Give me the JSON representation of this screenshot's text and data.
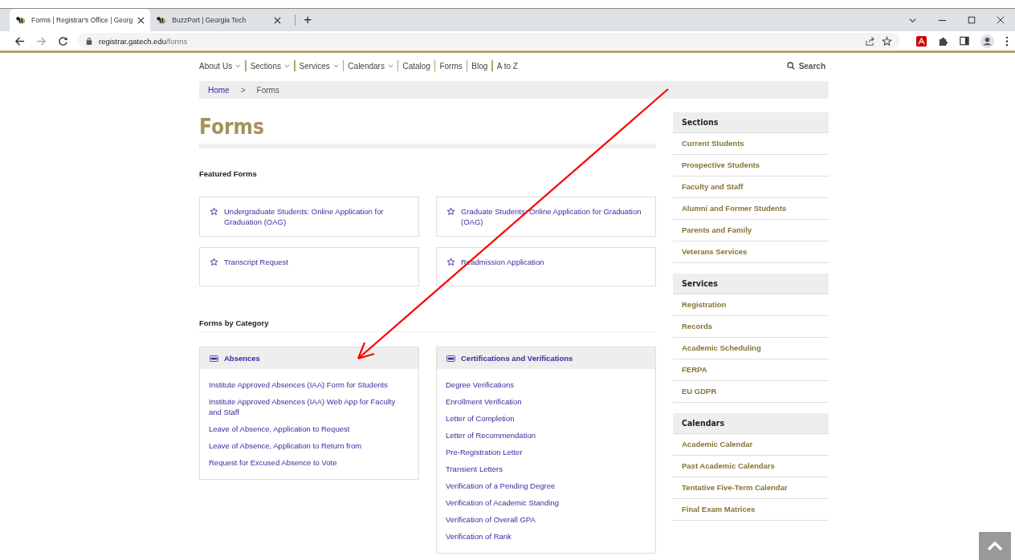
{
  "browser": {
    "tabs": [
      {
        "title": "Forms | Registrar's Office | Georg",
        "selected": true
      },
      {
        "title": "BuzzPort | Georgia Tech",
        "selected": false
      }
    ],
    "new_tab": "+",
    "url_host": "registrar.gatech.edu",
    "url_path": "/forms",
    "forward_disabled": true
  },
  "nav": {
    "items": [
      {
        "label": "About Us",
        "dropdown": true
      },
      {
        "label": "Sections",
        "dropdown": true
      },
      {
        "label": "Services",
        "dropdown": true
      },
      {
        "label": "Calendars",
        "dropdown": true
      },
      {
        "label": "Catalog",
        "dropdown": false
      },
      {
        "label": "Forms",
        "dropdown": false
      },
      {
        "label": "Blog",
        "dropdown": false
      },
      {
        "label": "A to Z",
        "dropdown": false
      }
    ],
    "search": "Search"
  },
  "breadcrumb": {
    "items": [
      "Home"
    ],
    "separator": ">",
    "current": "Forms"
  },
  "page_title": "Forms",
  "featured": {
    "heading": "Featured Forms",
    "items": [
      "Undergraduate Students: Online Application for Graduation (OAG)",
      "Graduate Students: Online Application for Graduation (OAG)",
      "Transcript Request",
      "Readmission Application"
    ]
  },
  "categories": {
    "heading": "Forms by Category",
    "groups": [
      {
        "title": "Absences",
        "links": [
          "Institute Approved Absences (IAA) Form for Students",
          "Institute Approved Absences (IAA) Web App for Faculty and Staff",
          "Leave of Absence, Application to Request",
          "Leave of Absence, Application to Return from",
          "Request for Excused Absence to Vote"
        ]
      },
      {
        "title": "Certifications and Verifications",
        "links": [
          "Degree Verifications",
          "Enrollment Verification",
          "Letter of Completion",
          "Letter of Recommendation",
          "Pre-Registration Letter",
          "Transient Letters",
          "Verification of a Pending Degree",
          "Verification of Academic Standing",
          "Verification of Overall GPA",
          "Verification of Rank"
        ]
      }
    ]
  },
  "sidebar": [
    {
      "heading": "Sections",
      "items": [
        "Current Students",
        "Prospective Students",
        "Faculty and Staff",
        "Alumni and Former Students",
        "Parents and Family",
        "Veterans Services"
      ]
    },
    {
      "heading": "Services",
      "items": [
        "Registration",
        "Records",
        "Academic Scheduling",
        "FERPA",
        "EU GDPR"
      ]
    },
    {
      "heading": "Calendars",
      "items": [
        "Academic Calendar",
        "Past Academic Calendars",
        "Tentative Five-Term Calendar",
        "Final Exam Matrices"
      ]
    }
  ]
}
